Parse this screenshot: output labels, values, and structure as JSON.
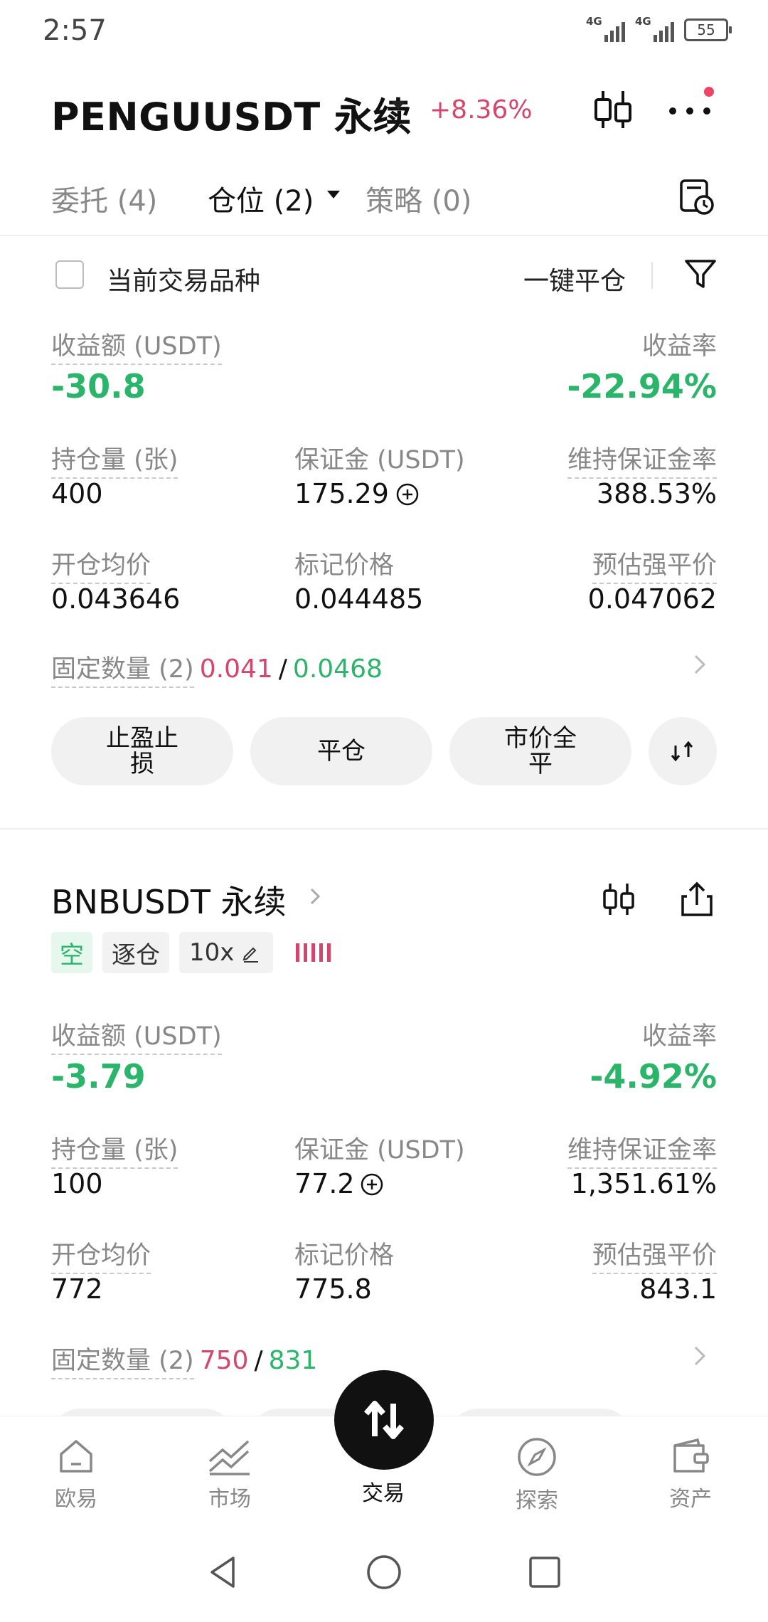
{
  "status": {
    "time": "2:57",
    "net1": "4G",
    "net2": "4G",
    "battery": "55"
  },
  "header": {
    "title": "PENGUUSDT 永续",
    "change": "+8.36%"
  },
  "tabs": [
    {
      "label": "委托 (4)"
    },
    {
      "label": "仓位 (2)"
    },
    {
      "label": "策略 (0)"
    }
  ],
  "filter": {
    "checkbox_label": "当前交易品种",
    "close_all": "一键平仓"
  },
  "position1": {
    "pnl_label": "收益额 (USDT)",
    "pnl": "-30.8",
    "roi_label": "收益率",
    "roi": "-22.94%",
    "size_label": "持仓量 (张)",
    "size": "400",
    "margin_label": "保证金 (USDT)",
    "margin": "175.29",
    "mmr_label": "维持保证金率",
    "mmr": "388.53%",
    "entry_label": "开仓均价",
    "entry": "0.043646",
    "mark_label": "标记价格",
    "mark": "0.044485",
    "liq_label": "预估强平价",
    "liq": "0.047062",
    "fixed_label": "固定数量 (2)",
    "fixed_a": "0.041",
    "fixed_sep": "/",
    "fixed_b": "0.0468",
    "btn_tpsl": "止盈止损",
    "btn_close": "平仓",
    "btn_market_close": "市价全平"
  },
  "position2": {
    "symbol": "BNBUSDT 永续",
    "tag_side": "空",
    "tag_mode": "逐仓",
    "tag_lev": "10x",
    "pnl_label": "收益额 (USDT)",
    "pnl": "-3.79",
    "roi_label": "收益率",
    "roi": "-4.92%",
    "size_label": "持仓量 (张)",
    "size": "100",
    "margin_label": "保证金 (USDT)",
    "margin": "77.2",
    "mmr_label": "维持保证金率",
    "mmr": "1,351.61%",
    "entry_label": "开仓均价",
    "entry": "772",
    "mark_label": "标记价格",
    "mark": "775.8",
    "liq_label": "预估强平价",
    "liq": "843.1",
    "fixed_label": "固定数量 (2)",
    "fixed_a": "750",
    "fixed_sep": "/",
    "fixed_b": "831"
  },
  "bottom_nav": [
    {
      "label": "欧易",
      "icon": "home-icon"
    },
    {
      "label": "市场",
      "icon": "market-chart-icon"
    },
    {
      "label": "交易",
      "icon": "trade-swap-icon"
    },
    {
      "label": "探索",
      "icon": "compass-icon"
    },
    {
      "label": "资产",
      "icon": "wallet-icon"
    }
  ],
  "colors": {
    "red": "#d5466c",
    "green": "#2ab56a"
  }
}
